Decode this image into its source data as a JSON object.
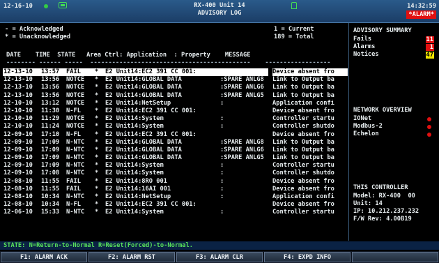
{
  "titlebar": {
    "date": "12-16-10",
    "unit": "RX-400 Unit 14",
    "log_title": "ADVISORY LOG",
    "time": "14:32:59",
    "alarm": "*ALARM*"
  },
  "legend": {
    "ack": "- = Acknowledged",
    "unack": "* = Unacknowledged",
    "current": "1 = Current",
    "total": "189 = Total"
  },
  "columns": {
    "header": "DATE    TIME  STATE   Area Ctrl: Application  : Property    MESSAGE",
    "separator": "-------- ------ -----  --------------------------------------------    ------------------"
  },
  "rows": [
    {
      "date": "12-13-10",
      "time": "13:57",
      "state": "FAIL",
      "ack": "*",
      "area": "E2 Unit14:EC2 391 CC 001:",
      "prop": "",
      "msg": "Device absent fro",
      "selected": true
    },
    {
      "date": "12-13-10",
      "time": "13:56",
      "state": "NOTCE",
      "ack": "*",
      "area": "E2 Unit14:GLOBAL DATA",
      "prop": ":SPARE ANLG8",
      "msg": "Link to Output ba"
    },
    {
      "date": "12-13-10",
      "time": "13:56",
      "state": "NOTCE",
      "ack": "*",
      "area": "E2 Unit14:GLOBAL DATA",
      "prop": ":SPARE ANLG6",
      "msg": "Link to Output ba"
    },
    {
      "date": "12-13-10",
      "time": "13:56",
      "state": "NOTCE",
      "ack": "*",
      "area": "E2 Unit14:GLOBAL DATA",
      "prop": ":SPARE ANLG5",
      "msg": "Link to Output ba"
    },
    {
      "date": "12-10-10",
      "time": "13:12",
      "state": "NOTCE",
      "ack": "*",
      "area": "E2 Unit14:NetSetup",
      "prop": ":",
      "msg": "Application confi"
    },
    {
      "date": "12-10-10",
      "time": "11:30",
      "state": "N-FL",
      "ack": "*",
      "area": "E2 Unit14:EC2 391 CC 001:",
      "prop": "",
      "msg": "Device absent fro"
    },
    {
      "date": "12-10-10",
      "time": "11:29",
      "state": "NOTCE",
      "ack": "*",
      "area": "E2 Unit14:System",
      "prop": ":",
      "msg": "Controller startu"
    },
    {
      "date": "12-10-10",
      "time": "11:24",
      "state": "NOTCE",
      "ack": "*",
      "area": "E2 Unit14:System",
      "prop": ":",
      "msg": "Controller shutdo"
    },
    {
      "date": "12-09-10",
      "time": "17:10",
      "state": "N-FL",
      "ack": "*",
      "area": "E2 Unit14:EC2 391 CC 001:",
      "prop": "",
      "msg": "Device absent fro"
    },
    {
      "date": "12-09-10",
      "time": "17:09",
      "state": "N-NTC",
      "ack": "*",
      "area": "E2 Unit14:GLOBAL DATA",
      "prop": ":SPARE ANLG8",
      "msg": "Link to Output ba"
    },
    {
      "date": "12-09-10",
      "time": "17:09",
      "state": "N-NTC",
      "ack": "*",
      "area": "E2 Unit14:GLOBAL DATA",
      "prop": ":SPARE ANLG6",
      "msg": "Link to Output ba"
    },
    {
      "date": "12-09-10",
      "time": "17:09",
      "state": "N-NTC",
      "ack": "*",
      "area": "E2 Unit14:GLOBAL DATA",
      "prop": ":SPARE ANLG5",
      "msg": "Link to Output ba"
    },
    {
      "date": "12-09-10",
      "time": "17:09",
      "state": "N-NTC",
      "ack": "*",
      "area": "E2 Unit14:System",
      "prop": ":",
      "msg": "Controller startu"
    },
    {
      "date": "12-09-10",
      "time": "17:08",
      "state": "N-NTC",
      "ack": "*",
      "area": "E2 Unit14:System",
      "prop": ":",
      "msg": "Controller shutdo"
    },
    {
      "date": "12-08-10",
      "time": "11:55",
      "state": "FAIL",
      "ack": "*",
      "area": "E2 Unit14:8RO 001",
      "prop": ":",
      "msg": "Device absent fro"
    },
    {
      "date": "12-08-10",
      "time": "11:55",
      "state": "FAIL",
      "ack": "*",
      "area": "E2 Unit14:16AI 001",
      "prop": ":",
      "msg": "Device absent fro"
    },
    {
      "date": "12-08-10",
      "time": "10:34",
      "state": "N-NTC",
      "ack": "*",
      "area": "E2 Unit14:NetSetup",
      "prop": ":",
      "msg": "Application confi"
    },
    {
      "date": "12-08-10",
      "time": "10:34",
      "state": "N-FL",
      "ack": "*",
      "area": "E2 Unit14:EC2 391 CC 001:",
      "prop": "",
      "msg": "Device absent fro"
    },
    {
      "date": "12-06-10",
      "time": "15:33",
      "state": "N-NTC",
      "ack": "*",
      "area": "E2 Unit14:System",
      "prop": ":",
      "msg": "Controller startu"
    }
  ],
  "status_line": "STATE: N=Return-to-Normal R=Reset(Forced)-to-Normal.",
  "fkeys": [
    "F1: ALARM ACK",
    "F2: ALARM RST",
    "F3: ALARM CLR",
    "F4: EXPD INFO"
  ],
  "advisory_summary": {
    "title": "ADVISORY SUMMARY",
    "fails_label": "Fails",
    "fails_value": "11",
    "alarms_label": "Alarms",
    "alarms_value": "1",
    "notices_label": "Notices",
    "notices_value": "47"
  },
  "network_overview": {
    "title": "NETWORK OVERVIEW",
    "items": [
      "IONet",
      "Modbus-2",
      "Echelon"
    ]
  },
  "this_controller": {
    "title": "THIS CONTROLLER",
    "model": "Model: RX-400  00",
    "unit": "Unit: 14",
    "ip": "IP: 10.212.237.232",
    "fw": "F/W Rev: 4.00B19"
  },
  "colors": {
    "header_blue": "#1b3d66",
    "alarm_red": "#e01010",
    "notice_yellow": "#f2e400",
    "status_green": "#58e05a"
  },
  "icons": {
    "status_dot": "green-dot-icon",
    "network": "network-icon",
    "lock": "lock-icon"
  }
}
